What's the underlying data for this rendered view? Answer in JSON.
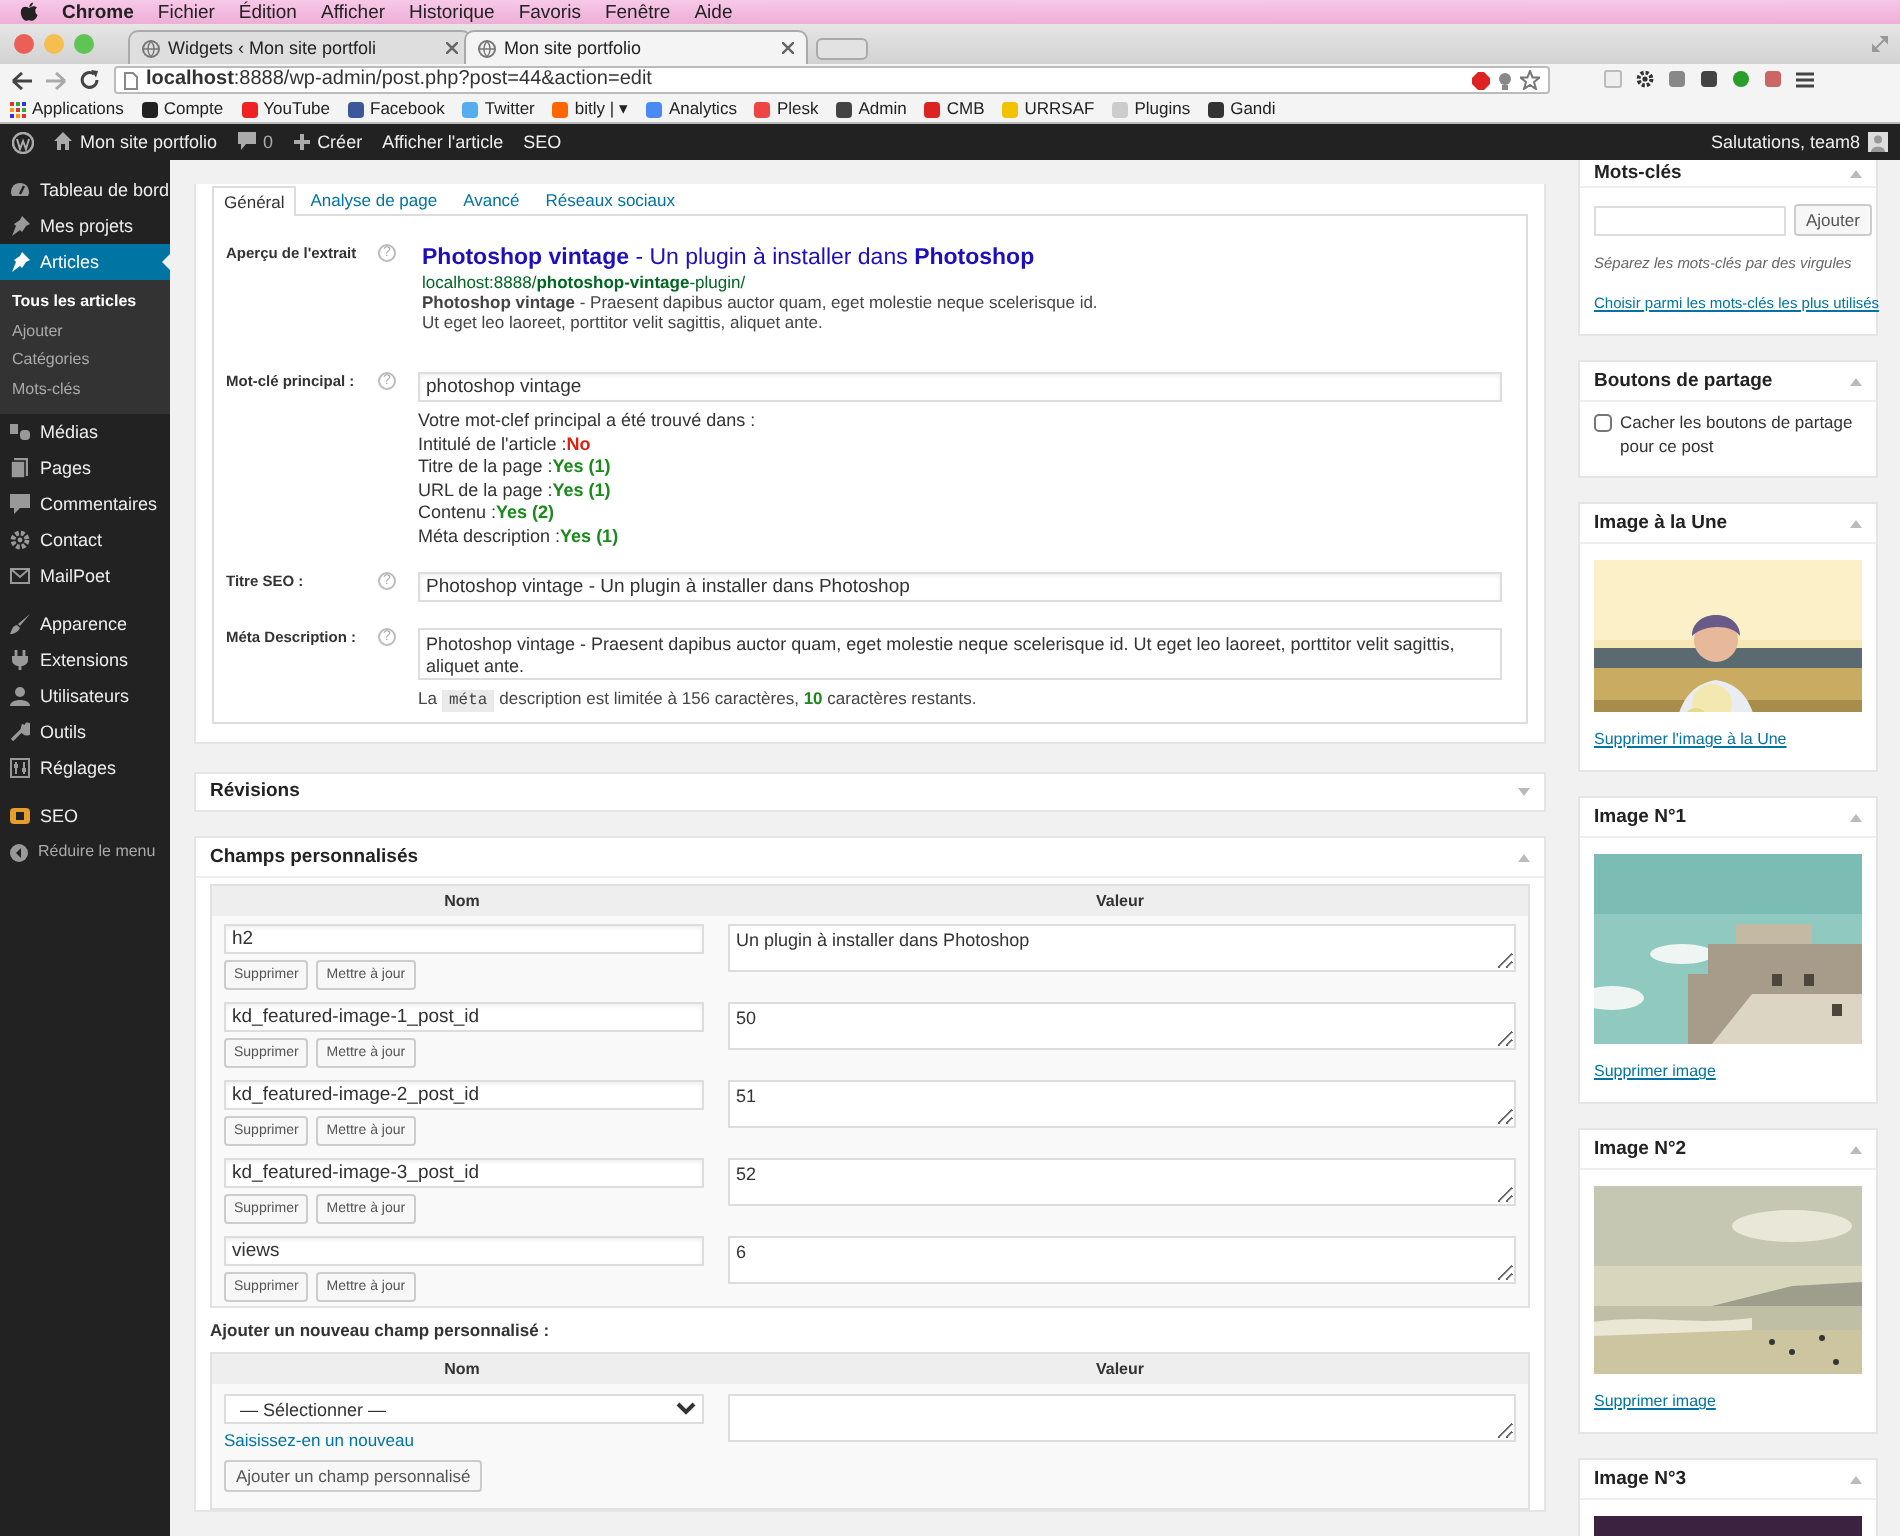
{
  "menubar": {
    "app": "Chrome",
    "items": [
      "Fichier",
      "Édition",
      "Afficher",
      "Historique",
      "Favoris",
      "Fenêtre",
      "Aide"
    ]
  },
  "browser_tabs": [
    {
      "title": "Widgets ‹ Mon site portfoli",
      "selected": false
    },
    {
      "title": "Mon site portfolio",
      "selected": true
    }
  ],
  "address_bar": {
    "url": "**localhost**:8888/wp-admin/post.php?post=44&action=edit"
  },
  "bookmarks": [
    "Applications",
    "Compte",
    "YouTube",
    "Facebook",
    "Twitter",
    "bitly | ▾",
    "Analytics",
    "Plesk",
    "Admin",
    "CMB",
    "URRSAF",
    "Plugins",
    "Gandi"
  ],
  "admin_bar": {
    "site": "Mon site portfolio",
    "comments": "0",
    "new": "Créer",
    "links": [
      "Afficher l'article",
      "SEO"
    ],
    "greeting": "Salutations, team8"
  },
  "sidebar": {
    "groups": [
      [
        {
          "label": "Tableau de bord",
          "selected": false
        },
        {
          "label": "Mes projets",
          "selected": false
        },
        {
          "label": "Articles",
          "selected": true,
          "children": [
            {
              "label": "Tous les articles",
              "selected": true
            },
            {
              "label": "Ajouter",
              "selected": false
            },
            {
              "label": "Catégories",
              "selected": false
            },
            {
              "label": "Mots-clés",
              "selected": false
            }
          ]
        },
        {
          "label": "Médias",
          "selected": false
        },
        {
          "label": "Pages",
          "selected": false
        },
        {
          "label": "Commentaires",
          "selected": false
        },
        {
          "label": "Contact",
          "selected": false
        },
        {
          "label": "MailPoet",
          "selected": false
        }
      ],
      [
        {
          "label": "Apparence",
          "selected": false
        },
        {
          "label": "Extensions",
          "selected": false
        },
        {
          "label": "Utilisateurs",
          "selected": false
        },
        {
          "label": "Outils",
          "selected": false
        },
        {
          "label": "Réglages",
          "selected": false
        }
      ],
      [
        {
          "label": "SEO",
          "selected": false
        }
      ]
    ],
    "collapse": "Réduire le menu"
  },
  "seo_box": {
    "tabs": [
      {
        "label": "Général",
        "selected": true
      },
      {
        "label": "Analyse de page",
        "selected": false
      },
      {
        "label": "Avancé",
        "selected": false
      },
      {
        "label": "Réseaux sociaux",
        "selected": false
      }
    ],
    "snippet": {
      "label": "Aperçu de l'extrait",
      "help": "?",
      "title": "**Photoshop vintage** - Un plugin à installer dans **Photoshop**",
      "url": "localhost:8888/**photoshop-vintage**-plugin/",
      "description": [
        "**Photoshop vintage** - Praesent dapibus auctor quam, eget molestie neque scelerisque id.",
        "Ut eget leo laoreet, porttitor velit sagittis, aliquet ante."
      ]
    },
    "focus_keyword": {
      "label": "Mot-clé principal :",
      "help": "?",
      "value": "photoshop vintage",
      "found_intro": "Votre mot-clef principal a été trouvé dans :",
      "checks": [
        {
          "label": "Intitulé de l'article :",
          "result": "No",
          "found": false
        },
        {
          "label": "Titre de la page :",
          "result": "Yes (1)",
          "found": true
        },
        {
          "label": "URL de la page :",
          "result": "Yes (1)",
          "found": true
        },
        {
          "label": "Contenu :",
          "result": "Yes (2)",
          "found": true
        },
        {
          "label": "Méta description :",
          "result": "Yes (1)",
          "found": true
        }
      ]
    },
    "seo_title": {
      "label": "Titre SEO :",
      "help": "?",
      "value": "Photoshop vintage - Un plugin à installer dans Photoshop"
    },
    "meta_description": {
      "label": "Méta Description :",
      "help": "?",
      "value": "Photoshop vintage - Praesent dapibus auctor quam, eget molestie neque scelerisque id. Ut eget leo laoreet, porttitor velit sagittis, aliquet ante.",
      "note_start": "La",
      "note_code": "méta",
      "note_end": "description est limitée à 156 caractères, **10** caractères restants."
    }
  },
  "revisions": {
    "title": "Révisions",
    "expanded": false
  },
  "custom_fields": {
    "title": "Champs personnalisés",
    "expanded": true,
    "columns": [
      "Nom",
      "Valeur"
    ],
    "rows": [
      {
        "name": "h2",
        "value": "Un plugin à installer dans Photoshop",
        "buttons": [
          "Supprimer",
          "Mettre à jour"
        ]
      },
      {
        "name": "kd_featured-image-1_post_id",
        "value": "50",
        "buttons": [
          "Supprimer",
          "Mettre à jour"
        ]
      },
      {
        "name": "kd_featured-image-2_post_id",
        "value": "51",
        "buttons": [
          "Supprimer",
          "Mettre à jour"
        ]
      },
      {
        "name": "kd_featured-image-3_post_id",
        "value": "52",
        "buttons": [
          "Supprimer",
          "Mettre à jour"
        ]
      },
      {
        "name": "views",
        "value": "6",
        "buttons": [
          "Supprimer",
          "Mettre à jour"
        ]
      }
    ],
    "add_title": "Ajouter un nouveau champ personnalisé :",
    "add_columns": [
      "Nom",
      "Valeur"
    ],
    "select": "— Sélectionner —",
    "new_link": "Saisissez-en un nouveau",
    "add_button": "Ajouter un champ personnalisé"
  },
  "side_boxes": [
    {
      "kind": "tags",
      "title": "Mots-clés",
      "expanded": true,
      "button": "Ajouter",
      "hint": "Séparez les mots-clés par des virgules",
      "link": "Choisir parmi les mots-clés les plus utilisés"
    },
    {
      "kind": "share",
      "title": "Boutons de partage",
      "expanded": true,
      "checkbox": "Cacher les boutons de partage pour ce post",
      "checked": false
    },
    {
      "title": "Image à la Une",
      "expanded": true,
      "link": "Supprimer l'image à la Une"
    },
    {
      "title": "Image N°1",
      "expanded": true,
      "link": "Supprimer image"
    },
    {
      "title": "Image N°2",
      "expanded": true,
      "link": "Supprimer image"
    },
    {
      "title": "Image N°3",
      "expanded": true
    }
  ]
}
